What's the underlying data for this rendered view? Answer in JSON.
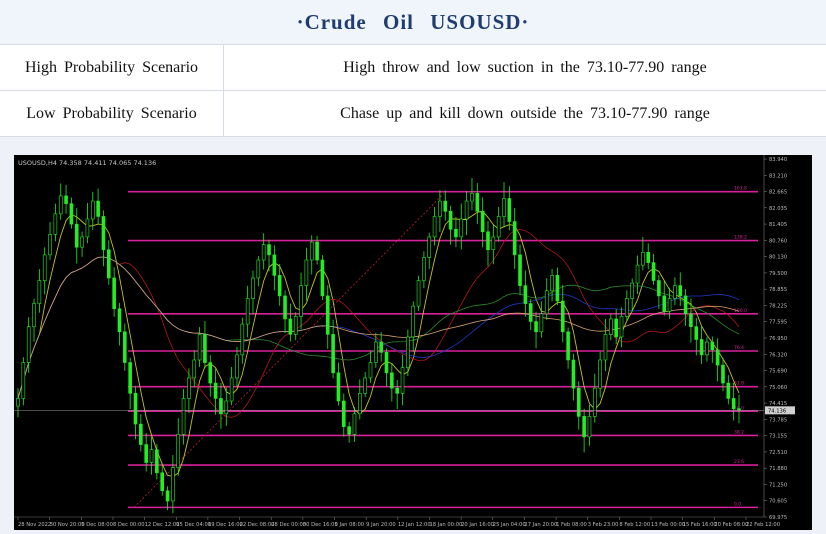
{
  "title": "·Crude  Oil  USOUSD·",
  "scenarios": [
    {
      "label": "High Probability Scenario",
      "text": "High throw and low suction in the 73.10-77.90 range"
    },
    {
      "label": "Low Probability Scenario",
      "text": "Chase up and kill down outside the 73.10-77.90 range"
    }
  ],
  "chart_data": {
    "type": "candlestick",
    "header": "USOUSD,H4  74.358 74.411 74.065 74.136",
    "price_range": [
      69.975,
      83.94
    ],
    "y_ticks": [
      "83.940",
      "83.210",
      "82.665",
      "82.035",
      "81.405",
      "80.760",
      "80.130",
      "79.500",
      "78.855",
      "78.225",
      "77.595",
      "76.950",
      "76.320",
      "75.690",
      "75.060",
      "74.415",
      "73.785",
      "73.155",
      "72.510",
      "71.880",
      "71.250",
      "70.605",
      "69.975"
    ],
    "x_ticks": [
      "28 Nov 2022",
      "30 Nov 20:00",
      "5 Dec 08:00",
      "8 Dec 00:00",
      "12 Dec 12:00",
      "15 Dec 04:00",
      "19 Dec 16:00",
      "22 Dec 08:00",
      "28 Dec 00:00",
      "30 Dec 16:00",
      "5 Jan 08:00",
      "9 Jan 20:00",
      "12 Jan 12:00",
      "18 Jan 00:00",
      "20 Jan 16:00",
      "25 Jan 04:00",
      "27 Jan 20:00",
      "1 Feb 08:00",
      "3 Feb 23:00",
      "8 Feb 12:00",
      "13 Feb 00:00",
      "15 Feb 16:00",
      "20 Feb 08:00",
      "22 Feb 12:00"
    ],
    "fib_levels": [
      {
        "price": 82.665,
        "label": "161.8"
      },
      {
        "price": 80.76,
        "label": "138.2"
      },
      {
        "price": 77.9,
        "label": "100.0"
      },
      {
        "price": 76.45,
        "label": "76.4"
      },
      {
        "price": 75.06,
        "label": "61.8"
      },
      {
        "price": 74.1,
        "label": "50.0"
      },
      {
        "price": 73.155,
        "label": "38.2"
      },
      {
        "price": 72.0,
        "label": "23.6"
      },
      {
        "price": 70.35,
        "label": "0.0"
      }
    ],
    "current_price": "74.136",
    "current_price_value": 74.136,
    "closes": [
      74.6,
      76.0,
      77.4,
      78.3,
      79.2,
      80.2,
      81.0,
      81.8,
      82.5,
      82.2,
      81.4,
      80.5,
      80.9,
      81.6,
      82.3,
      81.7,
      80.4,
      79.3,
      78.1,
      77.2,
      76.0,
      74.8,
      73.6,
      72.8,
      72.1,
      72.6,
      71.7,
      71.0,
      70.6,
      71.9,
      73.2,
      74.6,
      75.4,
      76.1,
      77.1,
      76.0,
      75.2,
      74.6,
      74.0,
      74.5,
      75.4,
      76.3,
      77.5,
      78.5,
      79.3,
      80.0,
      80.6,
      80.2,
      79.4,
      78.6,
      77.7,
      77.1,
      77.8,
      79.0,
      80.0,
      80.7,
      80.0,
      78.6,
      77.1,
      75.6,
      74.5,
      73.5,
      73.2,
      74.0,
      74.8,
      75.4,
      76.0,
      76.8,
      76.4,
      75.6,
      75.0,
      74.8,
      75.8,
      77.0,
      78.2,
      79.2,
      80.1,
      80.9,
      81.7,
      82.3,
      81.9,
      81.2,
      80.9,
      81.6,
      82.3,
      82.6,
      81.9,
      81.1,
      80.4,
      80.9,
      81.7,
      82.4,
      81.5,
      80.2,
      79.0,
      78.3,
      77.6,
      77.2,
      77.9,
      78.8,
      79.4,
      78.4,
      77.2,
      76.1,
      75.0,
      73.9,
      73.1,
      73.9,
      75.0,
      76.1,
      77.1,
      77.7,
      77.0,
      77.8,
      78.5,
      79.1,
      79.8,
      80.3,
      79.9,
      79.2,
      78.6,
      78.0,
      78.5,
      79.0,
      78.6,
      77.9,
      77.4,
      76.9,
      76.3,
      76.8,
      76.5,
      75.9,
      75.2,
      74.6,
      74.2,
      74.136
    ]
  }
}
